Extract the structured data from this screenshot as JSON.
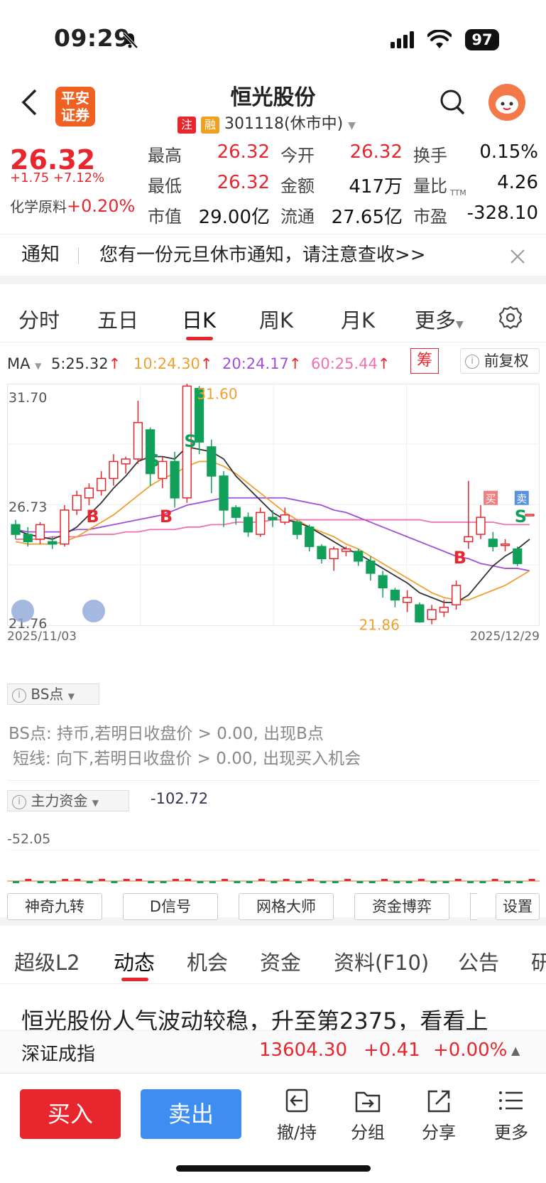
{
  "status_bar": {
    "time": "09:29",
    "battery": "97"
  },
  "header": {
    "title": "恒光股份",
    "badge_zhu": "注",
    "badge_rong": "融",
    "code_status": "301118(休市中)",
    "logo_line1": "平安",
    "logo_line2": "证券"
  },
  "quote": {
    "price": "26.32",
    "change": "+1.75 +7.12%",
    "sector_label": "化学原料",
    "sector_change": "+0.20%",
    "rows": [
      [
        {
          "l": "最高",
          "v": "26.32",
          "c": "red"
        },
        {
          "l": "今开",
          "v": "26.32",
          "c": "red"
        },
        {
          "l": "换手",
          "v": "0.15%",
          "c": "black"
        }
      ],
      [
        {
          "l": "最低",
          "v": "26.32",
          "c": "red"
        },
        {
          "l": "金额",
          "v": "417万",
          "c": "black"
        },
        {
          "l": "量比",
          "v": "4.26",
          "c": "black"
        }
      ],
      [
        {
          "l": "市值",
          "v": "29.00亿",
          "c": "black"
        },
        {
          "l": "流通",
          "v": "27.65亿",
          "c": "black"
        },
        {
          "l": "市盈",
          "v": "-328.10",
          "c": "black"
        }
      ]
    ],
    "ttm": "TTM"
  },
  "notice": {
    "label": "通知",
    "text": "您有一份元旦休市通知，请注意查收>>"
  },
  "k_tabs": [
    "分时",
    "五日",
    "日K",
    "周K",
    "月K",
    "更多"
  ],
  "k_active": "日K",
  "ma": {
    "label": "MA",
    "ma5": "5:25.32",
    "ma10": "10:24.30",
    "ma20": "20:24.17",
    "ma60": "60:25.44",
    "chou": "筹",
    "adjust": "前复权",
    "colors": {
      "ma5": "#333333",
      "ma10": "#f0a030",
      "ma20": "#a050d8",
      "ma60": "#f070b0"
    }
  },
  "chart_data": {
    "type": "candlestick",
    "y_axis_labels": [
      "31.70",
      "26.73",
      "21.76"
    ],
    "ylim": [
      21.76,
      31.7
    ],
    "x_start": "2025/11/03",
    "x_end": "2025/12/29",
    "max_label": "31.60",
    "min_label": "21.86",
    "bs_labels": [
      "B",
      "S",
      "B",
      "S",
      "B",
      "S"
    ],
    "buy_tag": "买",
    "sell_tag": "卖",
    "candles": [
      {
        "o": 25.9,
        "c": 25.5,
        "h": 26.1,
        "l": 25.3
      },
      {
        "o": 25.5,
        "c": 25.2,
        "h": 25.8,
        "l": 25.0
      },
      {
        "o": 25.3,
        "c": 25.9,
        "h": 26.0,
        "l": 25.1
      },
      {
        "o": 25.2,
        "c": 25.1,
        "h": 25.4,
        "l": 24.9
      },
      {
        "o": 25.1,
        "c": 26.5,
        "h": 26.7,
        "l": 25.0
      },
      {
        "o": 26.5,
        "c": 27.1,
        "h": 27.3,
        "l": 26.3
      },
      {
        "o": 27.0,
        "c": 27.4,
        "h": 27.6,
        "l": 26.7
      },
      {
        "o": 27.3,
        "c": 27.8,
        "h": 28.1,
        "l": 27.1
      },
      {
        "o": 27.8,
        "c": 28.5,
        "h": 28.8,
        "l": 27.5
      },
      {
        "o": 28.4,
        "c": 28.6,
        "h": 28.7,
        "l": 28.0
      },
      {
        "o": 28.6,
        "c": 30.1,
        "h": 31.0,
        "l": 28.4
      },
      {
        "o": 29.8,
        "c": 28.0,
        "h": 29.9,
        "l": 27.5
      },
      {
        "o": 27.8,
        "c": 28.5,
        "h": 28.7,
        "l": 27.4
      },
      {
        "o": 28.5,
        "c": 27.0,
        "h": 28.9,
        "l": 26.6
      },
      {
        "o": 27.0,
        "c": 31.6,
        "h": 31.7,
        "l": 26.8
      },
      {
        "o": 31.5,
        "c": 29.3,
        "h": 31.6,
        "l": 28.8
      },
      {
        "o": 29.1,
        "c": 27.9,
        "h": 29.4,
        "l": 27.2
      },
      {
        "o": 27.9,
        "c": 26.5,
        "h": 28.1,
        "l": 25.8
      },
      {
        "o": 26.6,
        "c": 26.2,
        "h": 26.7,
        "l": 25.9
      },
      {
        "o": 26.2,
        "c": 25.6,
        "h": 26.4,
        "l": 25.4
      },
      {
        "o": 25.5,
        "c": 26.4,
        "h": 26.6,
        "l": 25.4
      },
      {
        "o": 26.2,
        "c": 26.1,
        "h": 26.5,
        "l": 25.8
      },
      {
        "o": 26.0,
        "c": 26.3,
        "h": 26.6,
        "l": 25.9
      },
      {
        "o": 26.0,
        "c": 25.5,
        "h": 26.1,
        "l": 25.3
      },
      {
        "o": 25.8,
        "c": 25.0,
        "h": 25.9,
        "l": 24.8
      },
      {
        "o": 25.0,
        "c": 24.5,
        "h": 25.1,
        "l": 24.3
      },
      {
        "o": 24.5,
        "c": 24.9,
        "h": 25.0,
        "l": 24.0
      },
      {
        "o": 24.8,
        "c": 24.9,
        "h": 25.0,
        "l": 24.6
      },
      {
        "o": 24.8,
        "c": 24.4,
        "h": 24.9,
        "l": 24.2
      },
      {
        "o": 24.4,
        "c": 23.9,
        "h": 24.6,
        "l": 23.6
      },
      {
        "o": 23.8,
        "c": 23.3,
        "h": 24.0,
        "l": 22.9
      },
      {
        "o": 23.2,
        "c": 22.8,
        "h": 23.3,
        "l": 22.5
      },
      {
        "o": 22.7,
        "c": 22.9,
        "h": 23.2,
        "l": 22.3
      },
      {
        "o": 22.6,
        "c": 21.9,
        "h": 22.7,
        "l": 21.86
      },
      {
        "o": 22.0,
        "c": 22.4,
        "h": 22.6,
        "l": 21.8
      },
      {
        "o": 22.3,
        "c": 22.5,
        "h": 22.8,
        "l": 22.1
      },
      {
        "o": 22.6,
        "c": 23.4,
        "h": 23.6,
        "l": 22.4
      },
      {
        "o": 25.2,
        "c": 25.4,
        "h": 27.7,
        "l": 24.9
      },
      {
        "o": 25.5,
        "c": 26.2,
        "h": 26.7,
        "l": 25.3
      },
      {
        "o": 25.3,
        "c": 25.0,
        "h": 25.6,
        "l": 24.8
      },
      {
        "o": 25.1,
        "c": 25.1,
        "h": 25.3,
        "l": 24.8
      },
      {
        "o": 24.9,
        "c": 24.3,
        "h": 25.0,
        "l": 24.2
      },
      {
        "o": 26.3,
        "c": 26.32,
        "h": 26.32,
        "l": 26.3
      }
    ],
    "ma5": [
      25.7,
      25.5,
      25.4,
      25.3,
      25.5,
      25.8,
      26.3,
      26.8,
      27.4,
      27.9,
      28.5,
      28.7,
      28.7,
      28.6,
      29.1,
      29.0,
      28.9,
      28.6,
      27.9,
      27.4,
      26.9,
      26.4,
      26.1,
      26.0,
      25.8,
      25.5,
      25.2,
      24.9,
      24.7,
      24.4,
      24.1,
      23.8,
      23.5,
      23.1,
      22.9,
      22.7,
      22.7,
      23.0,
      23.6,
      24.2,
      24.6,
      24.9,
      25.3
    ],
    "ma10": [
      25.2,
      25.1,
      25.1,
      25.1,
      25.2,
      25.4,
      25.7,
      26.0,
      26.3,
      26.7,
      27.1,
      27.5,
      27.8,
      28.0,
      28.3,
      28.5,
      28.5,
      28.3,
      28.0,
      27.6,
      27.2,
      26.8,
      26.4,
      26.1,
      25.8,
      25.6,
      25.4,
      25.1,
      24.9,
      24.6,
      24.3,
      24.0,
      23.7,
      23.4,
      23.1,
      22.9,
      22.8,
      22.8,
      23.0,
      23.2,
      23.4,
      23.7,
      24.0
    ],
    "ma20": [
      25.7,
      25.6,
      25.6,
      25.6,
      25.6,
      25.7,
      25.7,
      25.8,
      25.9,
      26.0,
      26.1,
      26.2,
      26.3,
      26.5,
      26.7,
      26.8,
      26.9,
      27.0,
      27.0,
      27.0,
      27.0,
      27.0,
      27.0,
      26.9,
      26.8,
      26.7,
      26.5,
      26.4,
      26.2,
      26.0,
      25.8,
      25.6,
      25.4,
      25.2,
      25.0,
      24.8,
      24.6,
      24.5,
      24.3,
      24.2,
      24.1,
      24.1,
      24.0
    ],
    "ma60": [
      25.3,
      25.3,
      25.3,
      25.4,
      25.4,
      25.4,
      25.5,
      25.5,
      25.5,
      25.6,
      25.6,
      25.7,
      25.7,
      25.7,
      25.8,
      25.8,
      25.9,
      25.9,
      26.0,
      26.0,
      26.0,
      26.1,
      26.1,
      26.1,
      26.1,
      26.1,
      26.1,
      26.1,
      26.1,
      26.1,
      26.1,
      26.1,
      26.1,
      26.1,
      26.0,
      26.0,
      26.0,
      26.0,
      26.0,
      26.0,
      25.9,
      25.9,
      25.9
    ]
  },
  "bs_panel": {
    "label": "BS点",
    "line1": "BS点: 持币,若明日收盘价 > 0.00, 出现B点",
    "line2": "短线: 向下,若明日收盘价 > 0.00, 出现买入机会"
  },
  "fund_panel": {
    "label": "主力资金",
    "value": "-102.72",
    "axis": "-52.05"
  },
  "indicator_buttons": [
    "神奇九转",
    "D信号",
    "网格大师",
    "资金博弈"
  ],
  "settings_label": "设置",
  "info_tabs": [
    "超级L2",
    "动态",
    "机会",
    "资金",
    "资料(F10)",
    "公告",
    "研"
  ],
  "info_active": "动态",
  "headline": "恒光股份人气波动较稳，升至第2375，看看上",
  "index_bar": {
    "name": "深证成指",
    "value": "13604.30",
    "change": "+0.41",
    "pct": "+0.00%"
  },
  "bottom": {
    "buy": "买入",
    "sell": "卖出",
    "tools": [
      "撤/持",
      "分组",
      "分享",
      "更多"
    ]
  }
}
